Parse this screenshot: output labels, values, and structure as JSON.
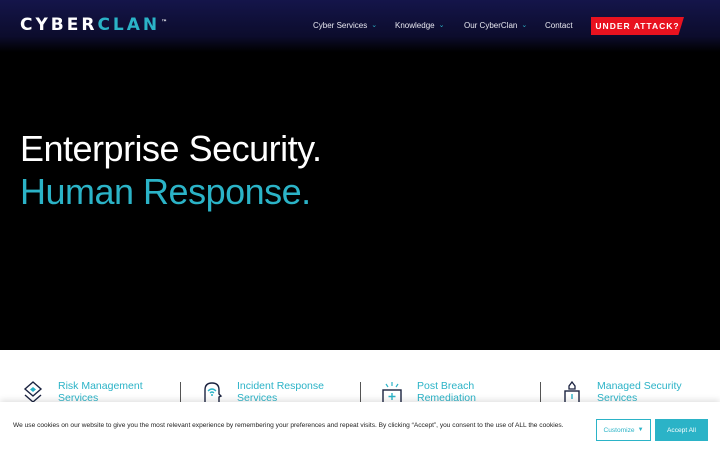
{
  "header": {
    "logo": {
      "part1": "CYBER",
      "part2": "CLAN",
      "tm": "™"
    },
    "nav": [
      {
        "label": "Cyber Services",
        "has_dropdown": true
      },
      {
        "label": "Knowledge",
        "has_dropdown": true
      },
      {
        "label": "Our CyberClan",
        "has_dropdown": true
      },
      {
        "label": "Contact",
        "has_dropdown": false
      }
    ],
    "cta_label": "UNDER ATTACK?"
  },
  "hero": {
    "line1": "Enterprise Security.",
    "line2": "Human Response."
  },
  "services": [
    {
      "label": "Risk Management Services",
      "icon": "risk-management-icon"
    },
    {
      "label": "Incident Response Services",
      "icon": "incident-response-icon"
    },
    {
      "label": "Post Breach Remediation",
      "icon": "post-breach-icon"
    },
    {
      "label": "Managed Security Services",
      "icon": "managed-security-icon"
    }
  ],
  "cookie": {
    "text": "We use cookies on our website to give you the most relevant experience by remembering your preferences and repeat visits. By clicking “Accept”, you consent to the use of ALL the cookies.",
    "customize_label": "Customize",
    "accept_label": "Accept All"
  },
  "colors": {
    "accent": "#2bb3c7",
    "alert": "#e8121f",
    "header": "#14154a"
  }
}
